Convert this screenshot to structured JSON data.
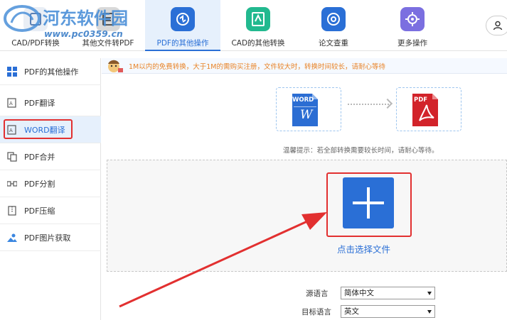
{
  "watermark": {
    "title": "河东软件园",
    "url": "www.pc0359.cn"
  },
  "tabs": [
    {
      "label": "CAD/PDF转换"
    },
    {
      "label": "其他文件转PDF"
    },
    {
      "label": "PDF的其他操作"
    },
    {
      "label": "CAD的其他转换"
    },
    {
      "label": "论文查重"
    },
    {
      "label": "更多操作"
    }
  ],
  "sidebar": {
    "items": [
      {
        "label": "PDF的其他操作"
      },
      {
        "label": "PDF翻译"
      },
      {
        "label": "WORD翻译"
      },
      {
        "label": "PDF合并"
      },
      {
        "label": "PDF分割"
      },
      {
        "label": "PDF压缩"
      },
      {
        "label": "PDF图片获取"
      }
    ]
  },
  "notice": {
    "text": "1M以内的免费转换，大于1M的需购买注册，文件较大时，转换时间较长，请耐心等待"
  },
  "conversion": {
    "from_label": "WORD",
    "from_letter": "W",
    "to_label": "PDF"
  },
  "tip": "温馨提示：若全部转换需要较长时间，请耐心等待。",
  "upload": {
    "label": "点击选择文件"
  },
  "language": {
    "source_label": "源语言",
    "source_value": "简体中文",
    "target_label": "目标语言",
    "target_value": "英文"
  },
  "colors": {
    "accent": "#2a6fd6",
    "highlight": "#e23030",
    "notice_text": "#e88428",
    "word_blue": "#2b6dd3",
    "pdf_red": "#d2232a"
  }
}
